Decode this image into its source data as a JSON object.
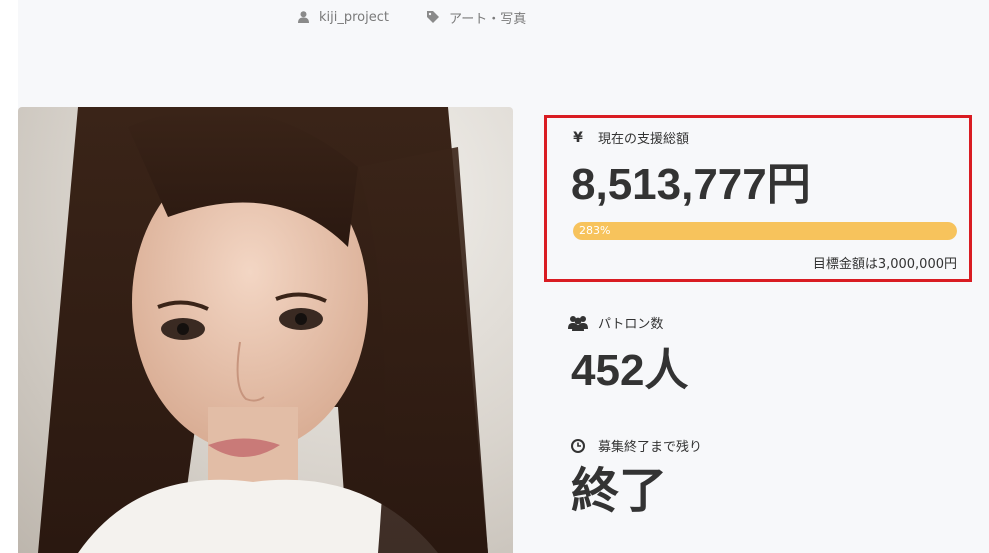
{
  "meta": {
    "author": "kiji_project",
    "category": "アート・写真"
  },
  "funding": {
    "label": "現在の支援総額",
    "amount": "8,513,777円",
    "progress_text": "283%",
    "progress_fraction": 1.0,
    "goal_text": "目標金額は3,000,000円",
    "highlight_color": "#d91c22",
    "bar_color": "#f7c35c"
  },
  "patrons": {
    "label": "パトロン数",
    "value": "452人"
  },
  "remaining": {
    "label": "募集終了まで残り",
    "value": "終了"
  },
  "icons": {
    "author": "user-icon",
    "category": "tag-icon",
    "funding": "yen-icon",
    "patrons": "users-icon",
    "remaining": "clock-icon"
  }
}
